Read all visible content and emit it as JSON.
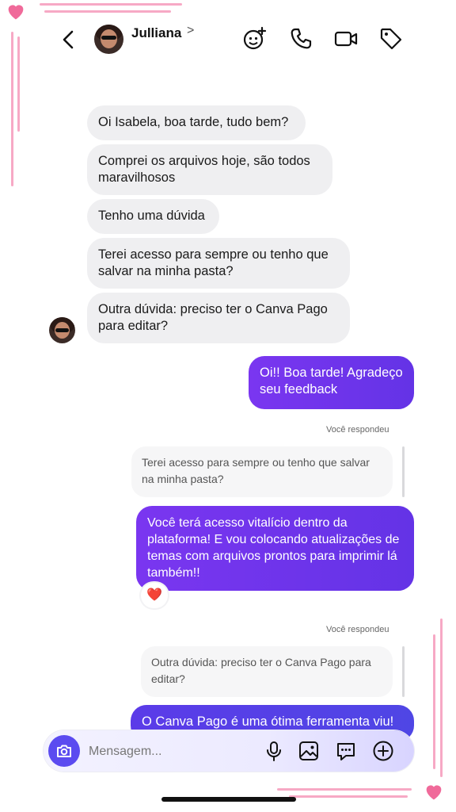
{
  "header": {
    "contact_name": "Julliana",
    "chevron": ">",
    "icons": [
      "back-icon",
      "add-effects-icon",
      "phone-icon",
      "video-icon",
      "tag-icon"
    ]
  },
  "messages": [
    {
      "type": "received",
      "text": "Oi Isabela, boa tarde, tudo bem?"
    },
    {
      "type": "received",
      "text": "Comprei os arquivos hoje, são todos maravilhosos"
    },
    {
      "type": "received",
      "text": "Tenho uma dúvida"
    },
    {
      "type": "received",
      "text": "Terei acesso para sempre ou tenho que salvar na minha pasta?"
    },
    {
      "type": "received",
      "text": "Outra dúvida: preciso ter o Canva Pago para editar?"
    },
    {
      "type": "sent",
      "text": "Oi!! Boa tarde! Agradeço seu feedback"
    },
    {
      "type": "replied_label",
      "text": "Você respondeu"
    },
    {
      "type": "quote",
      "text": "Terei acesso para sempre ou tenho que salvar na minha pasta?"
    },
    {
      "type": "sent",
      "text": "Você terá acesso vitalício dentro da plataforma! E vou colocando atualizações de temas com arquivos prontos para imprimir lá também!!",
      "reaction": "❤️"
    },
    {
      "type": "replied_label",
      "text": "Você respondeu"
    },
    {
      "type": "quote",
      "text": "Outra dúvida: preciso ter o Canva Pago para editar?"
    },
    {
      "type": "sent",
      "text": "O Canva Pago é uma ótima ferramenta viu!"
    }
  ],
  "composer": {
    "placeholder": "Mensagem...",
    "icons": [
      "camera-icon",
      "microphone-icon",
      "gallery-icon",
      "sticker-icon",
      "plus-icon"
    ]
  },
  "colors": {
    "sent_bubble": "#6a35ec",
    "received_bubble": "#efeff1",
    "accent": "#5b4bf0",
    "frame_pink": "#f7a9c5",
    "heart": "#f06a9a"
  }
}
